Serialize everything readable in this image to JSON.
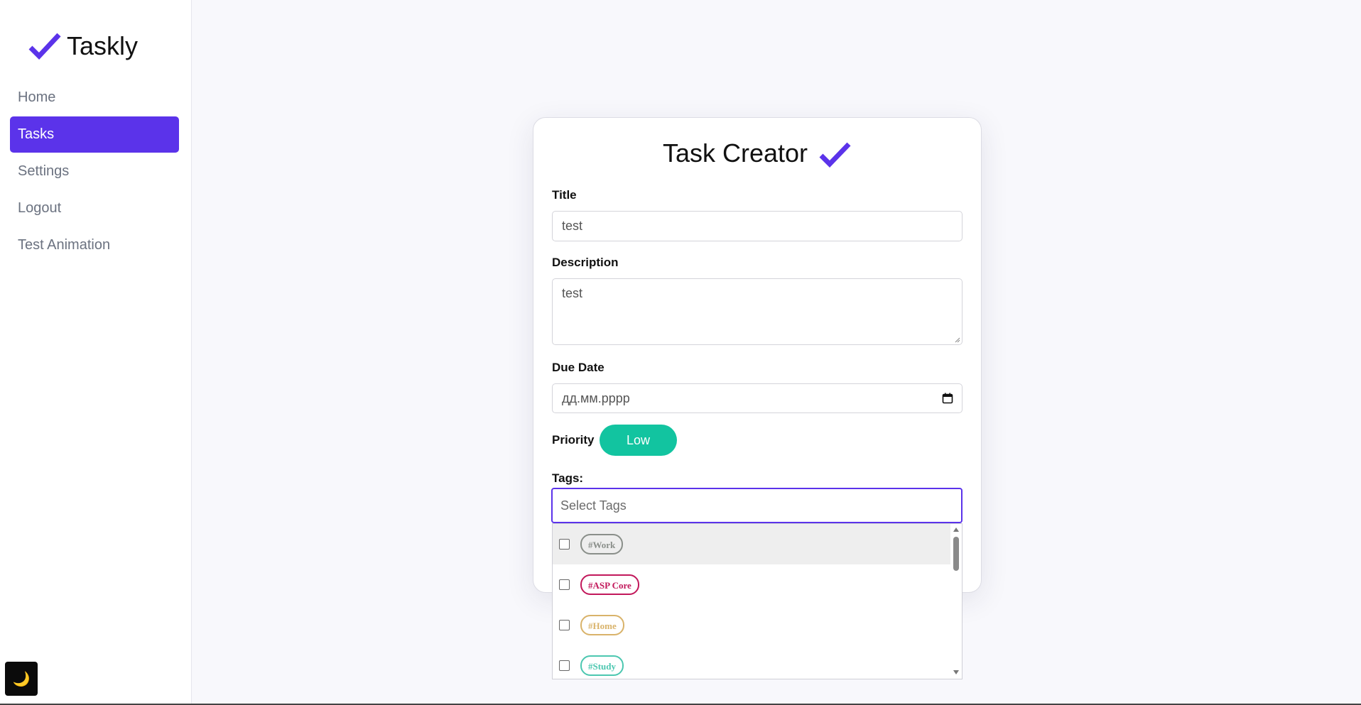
{
  "app": {
    "name": "Taskly"
  },
  "sidebar": {
    "items": [
      {
        "label": "Home"
      },
      {
        "label": "Tasks",
        "active": true
      },
      {
        "label": "Settings"
      },
      {
        "label": "Logout"
      },
      {
        "label": "Test Animation"
      }
    ],
    "theme_toggle_icon": "🌙"
  },
  "form": {
    "title": "Task Creator",
    "title_field": {
      "label": "Title",
      "value": "test"
    },
    "description_field": {
      "label": "Description",
      "value": "test"
    },
    "due_date_field": {
      "label": "Due Date",
      "placeholder": "дд.мм.рррр"
    },
    "priority": {
      "label": "Priority",
      "value": "Low",
      "color": "#12c4a0"
    },
    "tags": {
      "label": "Tags:",
      "placeholder": "Select Tags",
      "options": [
        {
          "label": "#Work",
          "color": "#8a8f8a",
          "checked": false
        },
        {
          "label": "#ASP Core",
          "color": "#c2185b",
          "checked": false
        },
        {
          "label": "#Home",
          "color": "#d9b36a",
          "checked": false
        },
        {
          "label": "#Study",
          "color": "#4cc7b0",
          "checked": false
        }
      ]
    }
  },
  "colors": {
    "accent": "#5b33ea",
    "background": "#f8f8fc"
  }
}
